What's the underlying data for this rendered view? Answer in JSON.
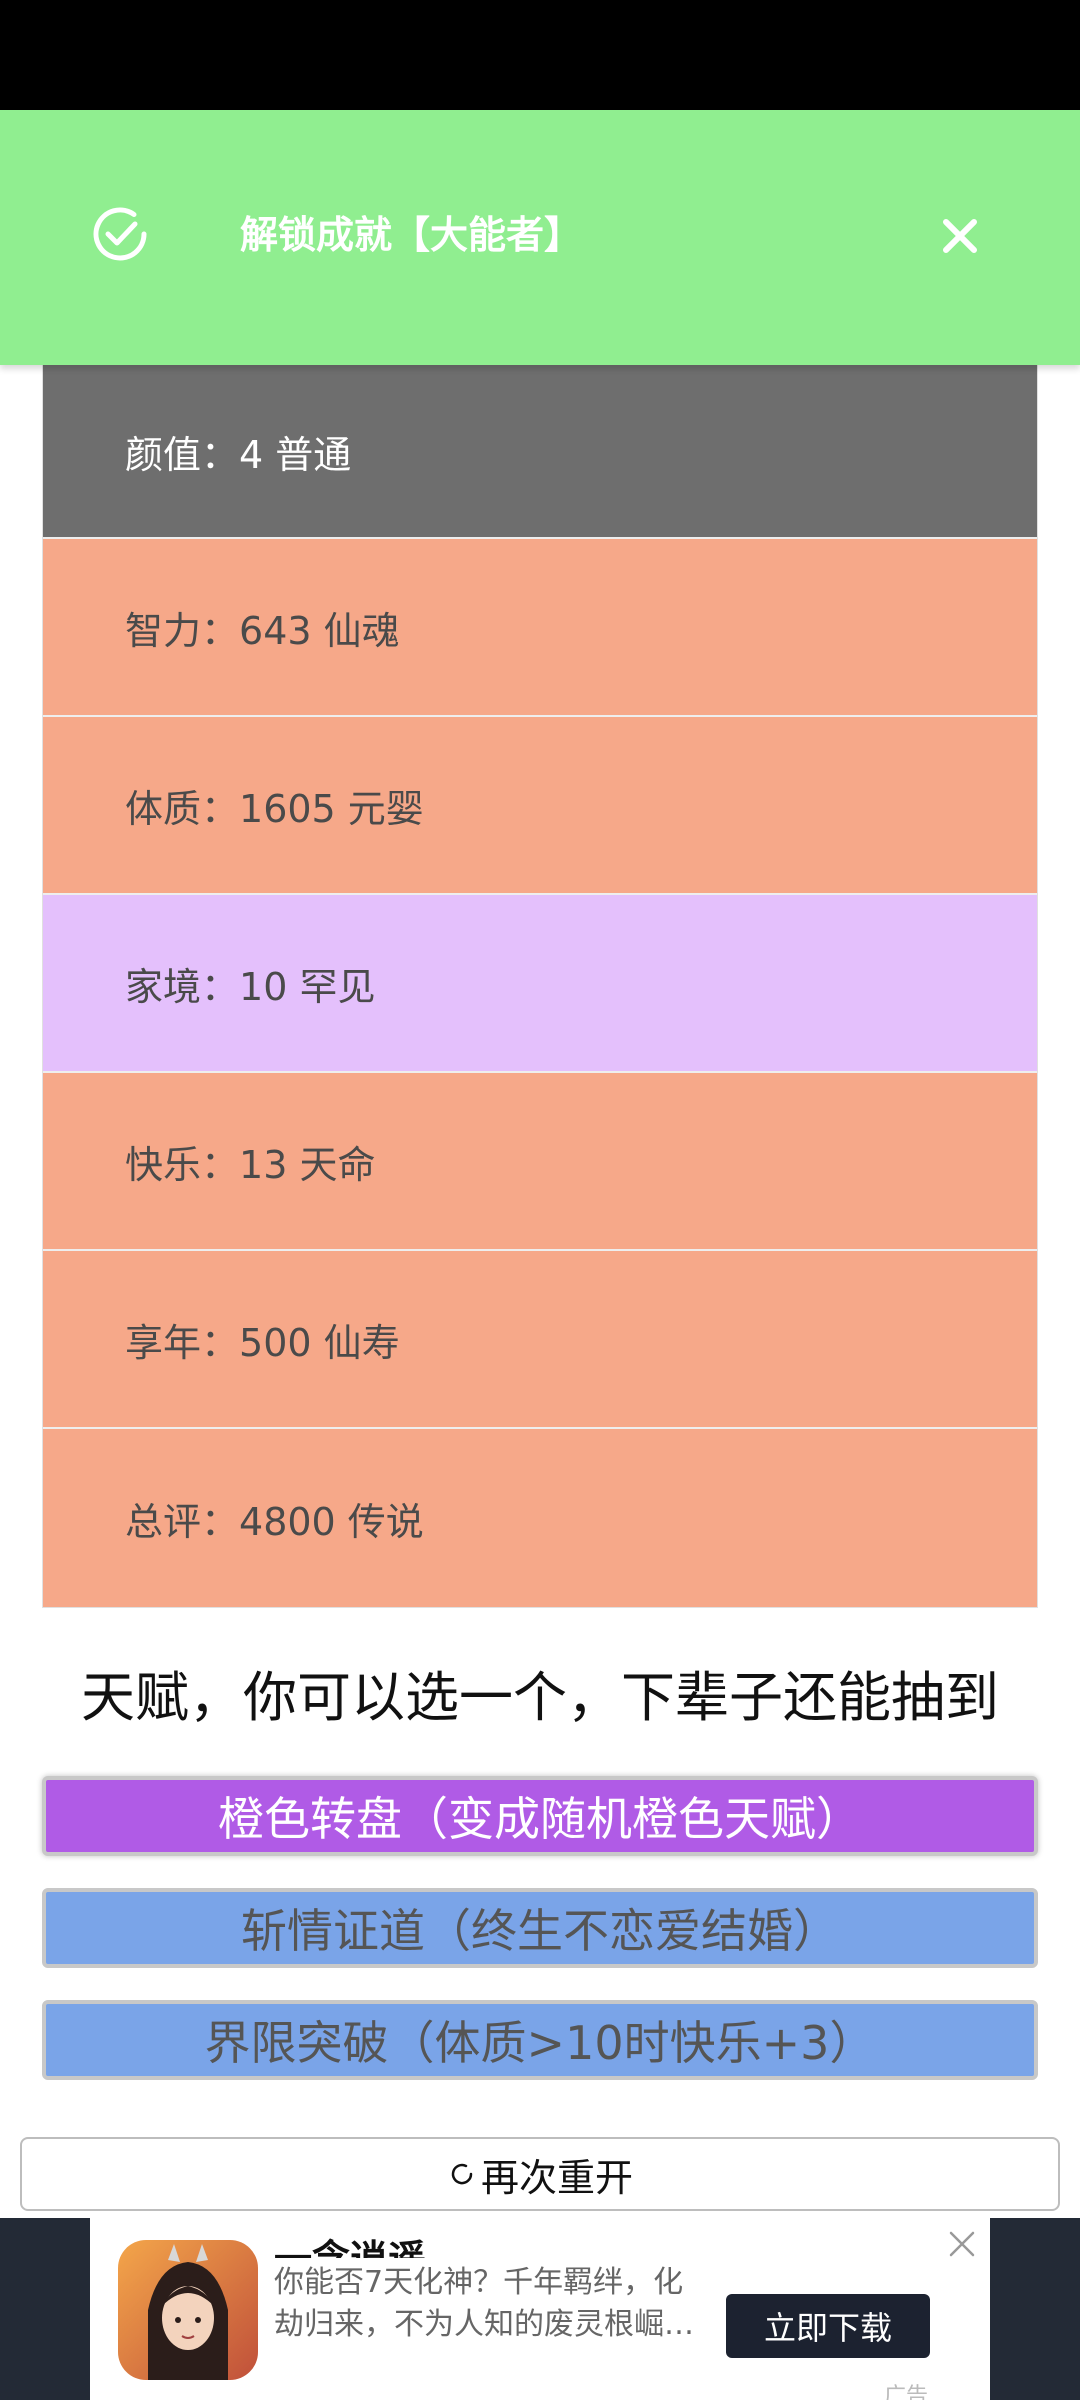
{
  "toast": {
    "message": "解锁成就【大能者】",
    "background": "#90ee90"
  },
  "stats": [
    {
      "label": "颜值：",
      "value": "4 普通",
      "color": "#6e6e6e",
      "text_color": "#ffffff"
    },
    {
      "label": "智力：",
      "value": "643 仙魂",
      "color": "#f6a889",
      "text_color": "#4a4a4a"
    },
    {
      "label": "体质：",
      "value": "1605 元婴",
      "color": "#f6a889",
      "text_color": "#4a4a4a"
    },
    {
      "label": "家境：",
      "value": "10 罕见",
      "color": "#e4c0fc",
      "text_color": "#4a4a4a"
    },
    {
      "label": "快乐：",
      "value": "13 天命",
      "color": "#f6a889",
      "text_color": "#4a4a4a"
    },
    {
      "label": "享年：",
      "value": "500 仙寿",
      "color": "#f6a889",
      "text_color": "#4a4a4a"
    },
    {
      "label": "总评：",
      "value": "4800 传说",
      "color": "#f6a889",
      "text_color": "#4a4a4a"
    }
  ],
  "talent_section": {
    "title": "天赋，你可以选一个，下辈子还能抽到",
    "options": [
      {
        "label": "橙色转盘（变成随机橙色天赋）",
        "color": "#b05be6",
        "selected": true
      },
      {
        "label": "斩情证道（终生不恋爱结婚）",
        "color": "#7aa4e8",
        "selected": false
      },
      {
        "label": "界限突破（体质>10时快乐+3）",
        "color": "#7aa4e8",
        "selected": false
      }
    ]
  },
  "restart": {
    "label": "再次重开",
    "icon": "refresh-icon"
  },
  "ad": {
    "title": "一念逍遥",
    "desc_line1": "你能否7天化神？千年羁绊，化",
    "desc_line2": "劫归来，不为人知的废灵根崛…",
    "button": "立即下载",
    "label": "广告"
  }
}
